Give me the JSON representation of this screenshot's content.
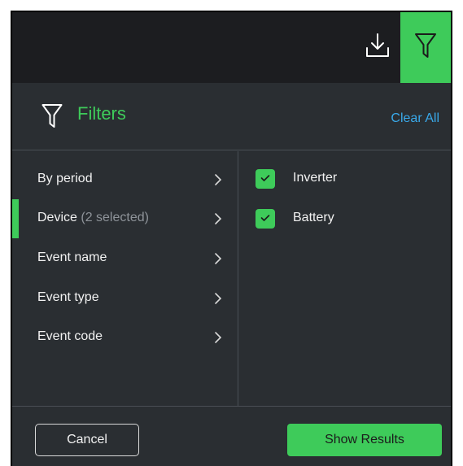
{
  "topbar": {
    "download_icon": "download-icon",
    "filter_icon": "filter-funnel-icon"
  },
  "header": {
    "icon": "filter-funnel-icon",
    "title": "Filters",
    "clear_all_label": "Clear All"
  },
  "categories": [
    {
      "label": "By period",
      "sub": "",
      "active": false
    },
    {
      "label": "Device",
      "sub": "(2 selected)",
      "active": true
    },
    {
      "label": "Event name",
      "sub": "",
      "active": false
    },
    {
      "label": "Event type",
      "sub": "",
      "active": false
    },
    {
      "label": "Event code",
      "sub": "",
      "active": false
    }
  ],
  "options": [
    {
      "label": "Inverter",
      "checked": true
    },
    {
      "label": "Battery",
      "checked": true
    }
  ],
  "footer": {
    "cancel_label": "Cancel",
    "show_results_label": "Show Results"
  },
  "colors": {
    "accent": "#3ecb5a",
    "link": "#39a9ea",
    "panel_bg": "#2a2e32",
    "topbar_bg": "#1c1d20"
  }
}
